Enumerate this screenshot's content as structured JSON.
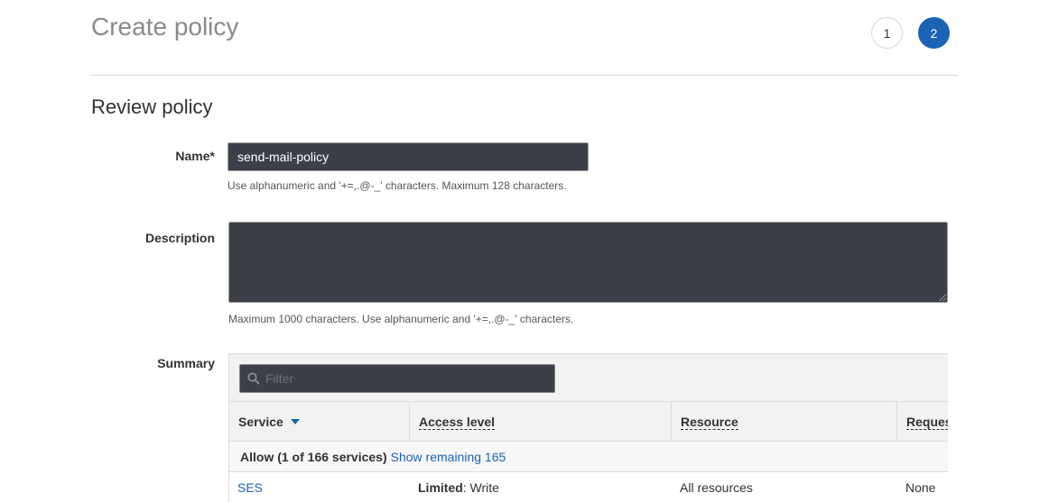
{
  "header": {
    "title": "Create policy",
    "steps": [
      "1",
      "2"
    ],
    "active_step": "2"
  },
  "review": {
    "title": "Review policy"
  },
  "name_field": {
    "label": "Name*",
    "value": "send-mail-policy",
    "hint": "Use alphanumeric and '+=,.@-_' characters. Maximum 128 characters."
  },
  "description_field": {
    "label": "Description",
    "value": "",
    "hint": "Maximum 1000 characters. Use alphanumeric and '+=,.@-_' characters."
  },
  "summary": {
    "label": "Summary",
    "filter_placeholder": "Filter",
    "columns": [
      "Service",
      "Access level",
      "Resource",
      "Reques"
    ],
    "sorted_column": "Service",
    "group": {
      "label": "Allow (1 of 166 services)",
      "link": "Show remaining 165"
    },
    "rows": [
      {
        "service": "SES",
        "access_level_bold": "Limited",
        "access_level_rest": ": Write",
        "resource": "All resources",
        "request": "None"
      }
    ]
  },
  "colors": {
    "primary": "#1a63b5",
    "input_bg": "#3c3f48",
    "title_gray": "#8a8a8a"
  }
}
